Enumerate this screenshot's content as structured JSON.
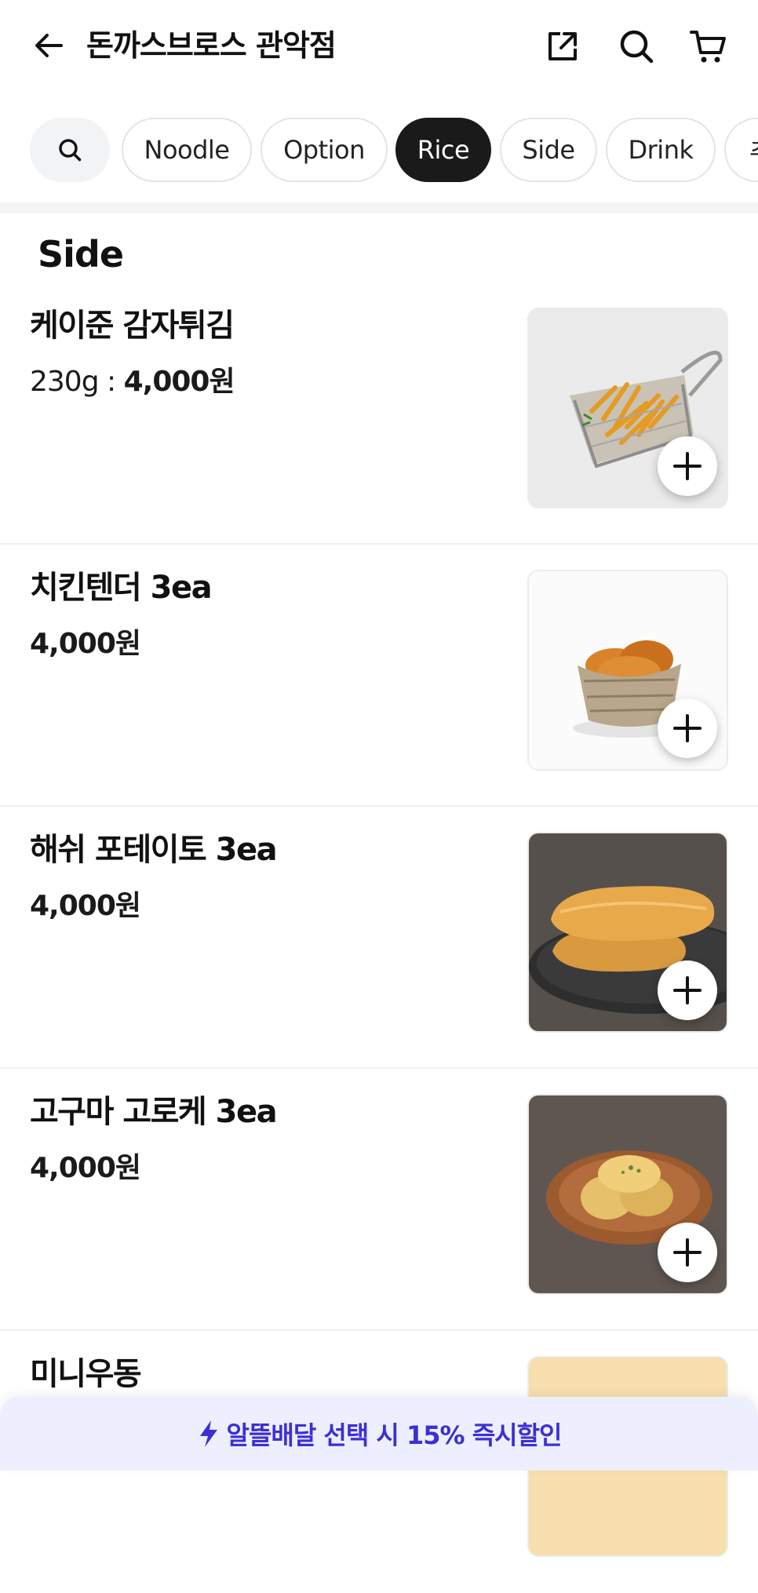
{
  "header": {
    "title": "돈까스브로스 관악점",
    "back_icon": "arrow-left-icon",
    "share_icon": "share-icon",
    "search_icon": "search-icon",
    "cart_icon": "cart-icon"
  },
  "tabs": [
    {
      "label": "Noodle",
      "active": false
    },
    {
      "label": "Option",
      "active": false
    },
    {
      "label": "Rice",
      "active": true
    },
    {
      "label": "Side",
      "active": false
    },
    {
      "label": "Drink",
      "active": false
    },
    {
      "label": "추",
      "active": false
    }
  ],
  "section": {
    "title": "Side"
  },
  "items": [
    {
      "name": "케이준 감자튀김",
      "weight": "230g : ",
      "price": "4,000원",
      "image": "cajun-fries-photo"
    },
    {
      "name": "치킨텐더 3ea",
      "weight": "",
      "price": "4,000원",
      "image": "chicken-tender-photo"
    },
    {
      "name": "해쉬 포테이토 3ea",
      "weight": "",
      "price": "4,000원",
      "image": "hash-potato-photo"
    },
    {
      "name": "고구마 고로케 3ea",
      "weight": "",
      "price": "4,000원",
      "image": "sweet-potato-croquette-photo"
    },
    {
      "name": "미니우동",
      "weight": "",
      "price": "",
      "image": "mini-udon-photo"
    }
  ],
  "promo": {
    "text": "알뜰배달 선택 시 15% 즉시할인",
    "icon": "lightning-icon"
  },
  "colors": {
    "accent": "#3b2fd6",
    "active_tab": "#1a1a1a",
    "promo_bg": "#eeeffe"
  }
}
